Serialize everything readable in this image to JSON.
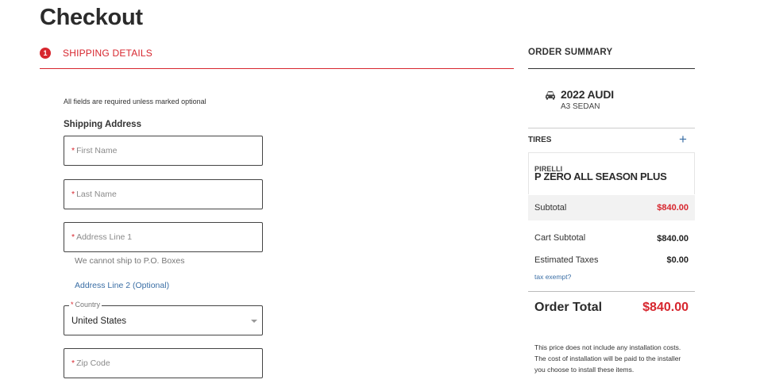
{
  "header": {
    "title": "Checkout"
  },
  "steps": {
    "number": "1",
    "label": "SHIPPING DETAILS"
  },
  "form": {
    "required_note": "All fields are required unless marked optional",
    "section_label": "Shipping Address",
    "required_mark": "*",
    "fields": {
      "first_name": {
        "placeholder": "First Name",
        "value": ""
      },
      "last_name": {
        "placeholder": "Last Name",
        "value": ""
      },
      "address1": {
        "placeholder": "Address Line 1",
        "value": ""
      },
      "zip": {
        "placeholder": "Zip Code",
        "value": ""
      }
    },
    "address1_helper": "We cannot ship to P.O. Boxes",
    "address2_link": "Address Line 2 (Optional)",
    "country": {
      "label": "Country",
      "value": "United States"
    }
  },
  "summary": {
    "title": "ORDER SUMMARY",
    "vehicle": {
      "icon": "car-icon",
      "make": "2022 AUDI",
      "model": "A3 SEDAN"
    },
    "tires_label": "TIRES",
    "add_symbol": "+",
    "tire": {
      "brand": "PIRELLI",
      "name": "P ZERO ALL SEASON PLUS"
    },
    "subtotal": {
      "label": "Subtotal",
      "value": "$840.00"
    },
    "cart_subtotal": {
      "label": "Cart Subtotal",
      "value": "$840.00"
    },
    "taxes": {
      "label": "Estimated Taxes",
      "value": "$0.00"
    },
    "tax_exempt_link": "tax exempt?",
    "order_total": {
      "label": "Order Total",
      "value": "$840.00"
    },
    "disclaimer": "This price does not include any installation costs. The cost of installation will be paid to the installer you choose to install these items."
  },
  "colors": {
    "accent": "#d7262e",
    "link": "#3a6ea5",
    "text": "#2b2b2b"
  }
}
